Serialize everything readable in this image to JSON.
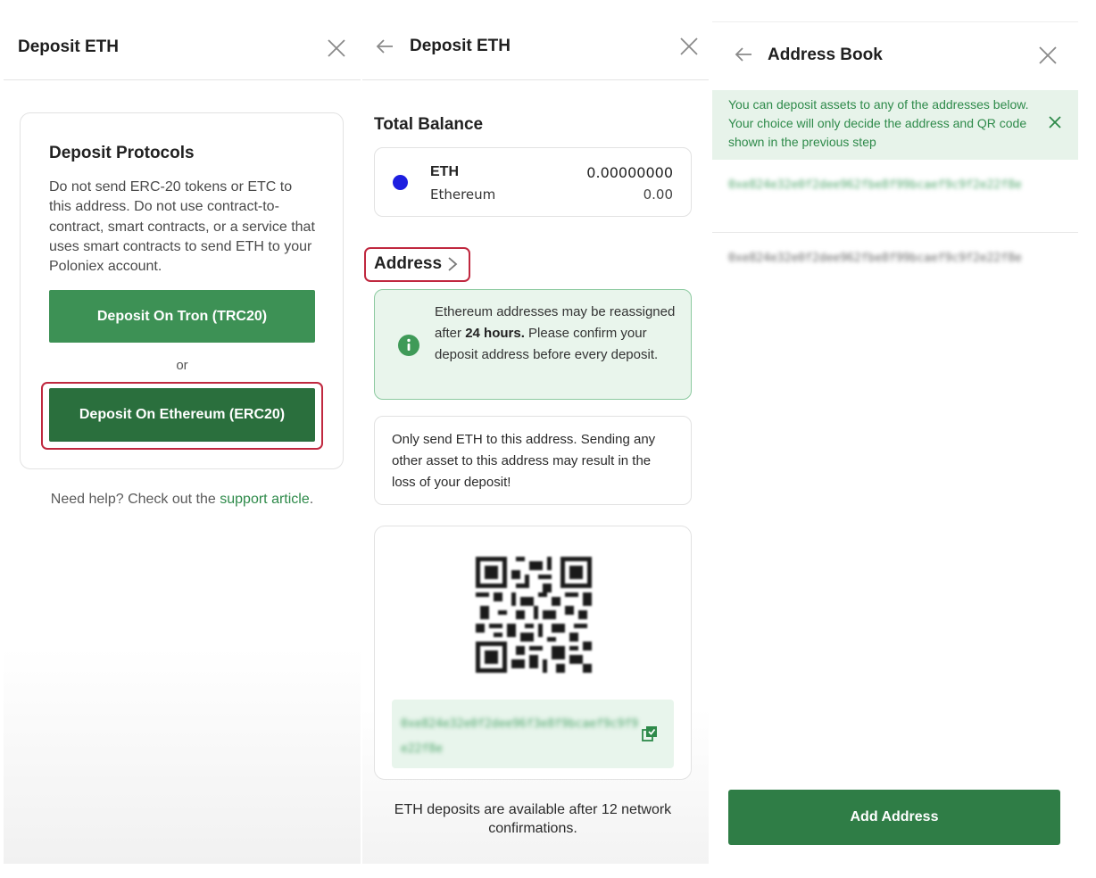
{
  "panel1": {
    "title": "Deposit ETH",
    "protocols": {
      "title": "Deposit Protocols",
      "description": "Do not send ERC-20 tokens or ETC to this address. Do not use contract-to-contract, smart contracts, or a service that uses smart contracts to send ETH to your Poloniex account.",
      "tron_button": "Deposit On Tron (TRC20)",
      "or_text": "or",
      "eth_button": "Deposit On Ethereum (ERC20)"
    },
    "help": {
      "prefix": "Need help? Check out the ",
      "link": "support article",
      "suffix": "."
    }
  },
  "panel2": {
    "title": "Deposit ETH",
    "balance_label": "Total Balance",
    "asset": {
      "symbol": "ETH",
      "name": "Ethereum",
      "balance": "0.00000000",
      "fiat": "0.00",
      "color": "#1d1ee0"
    },
    "address_label": "Address",
    "notice": {
      "before": "Ethereum addresses may be reassigned after ",
      "bold": "24 hours.",
      "after": " Please confirm your deposit address before every deposit."
    },
    "warning": "Only send ETH to this address. Sending any other asset to this address may result in the loss of your deposit!",
    "deposit_address": "0xe824e32e0f2dee96f3e8f9bcaef9c9f9e22f8e",
    "confirmations_note": "ETH deposits are available after 12 network confirmations."
  },
  "panel3": {
    "title": "Address Book",
    "banner": "You can deposit assets to any of the addresses below. Your choice will only decide the address and QR code shown in the previous step",
    "addresses": [
      "0xe824e32e0f2dee962fbe8f99bcaef9c9f2e22f8e",
      "0xe824e32e0f2dee962fbe8f99bcaef9c9f2e22f8e"
    ],
    "add_button": "Add Address"
  },
  "colors": {
    "accent_green": "#3d9155",
    "dark_green": "#2a6f3d",
    "highlight_red": "#c0283f",
    "notice_bg": "#e9f5ec"
  }
}
